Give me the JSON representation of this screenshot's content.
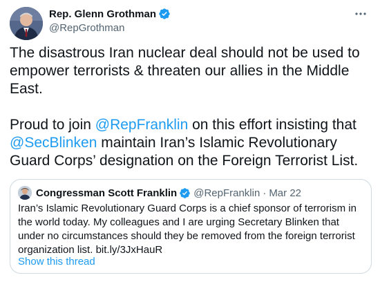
{
  "author": {
    "display_name": "Rep. Glenn Grothman",
    "handle": "@RepGrothman",
    "verified": true
  },
  "tweet": {
    "paragraph1": "The disastrous Iran nuclear deal should not be used to empower terrorists & threaten our allies in the Middle East.",
    "p2_text1": "Proud to join ",
    "p2_mention1": "@RepFranklin",
    "p2_text2": " on this effort insisting that ",
    "p2_mention2": "@SecBlinken",
    "p2_text3": " maintain Iran’s Islamic Revolutionary Guard Corps’ designation on the Foreign Terrorist List."
  },
  "quoted": {
    "display_name": "Congressman Scott Franklin",
    "handle": "@RepFranklin",
    "separator": "·",
    "date": "Mar 22",
    "text": "Iran’s Islamic Revolutionary Guard Corps is a chief sponsor of terrorism in the world today. My colleagues and I are urging Secretary Blinken that under no circumstances should they be removed from the foreign terrorist organization list. ",
    "link": "bit.ly/3JxHauR",
    "show_thread": "Show this thread"
  },
  "colors": {
    "accent": "#1d9bf0",
    "text": "#0f1419",
    "secondary": "#536471",
    "border": "#cfd9de"
  },
  "icons": {
    "verified": "verified-badge-icon",
    "more": "more-options-icon"
  }
}
